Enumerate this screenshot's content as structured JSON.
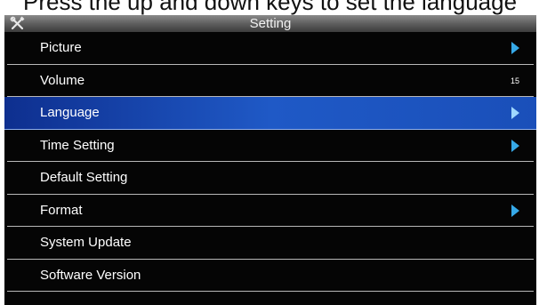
{
  "caption": "Press the up and down keys to set the language",
  "window": {
    "title": "Setting",
    "icon": "tools-icon"
  },
  "menu": {
    "items": [
      {
        "label": "Picture",
        "has_arrow": true,
        "value": "",
        "selected": false
      },
      {
        "label": "Volume",
        "has_arrow": false,
        "value": "15",
        "selected": false
      },
      {
        "label": "Language",
        "has_arrow": true,
        "value": "",
        "selected": true
      },
      {
        "label": "Time Setting",
        "has_arrow": true,
        "value": "",
        "selected": false
      },
      {
        "label": "Default Setting",
        "has_arrow": false,
        "value": "",
        "selected": false
      },
      {
        "label": "Format",
        "has_arrow": true,
        "value": "",
        "selected": false
      },
      {
        "label": "System Update",
        "has_arrow": false,
        "value": "",
        "selected": false
      },
      {
        "label": "Software Version",
        "has_arrow": false,
        "value": "",
        "selected": false
      }
    ]
  },
  "colors": {
    "background": "#050505",
    "selected_bar": "#1f59c6",
    "arrow": "#36a9e8",
    "divider": "#b8b8b8"
  }
}
